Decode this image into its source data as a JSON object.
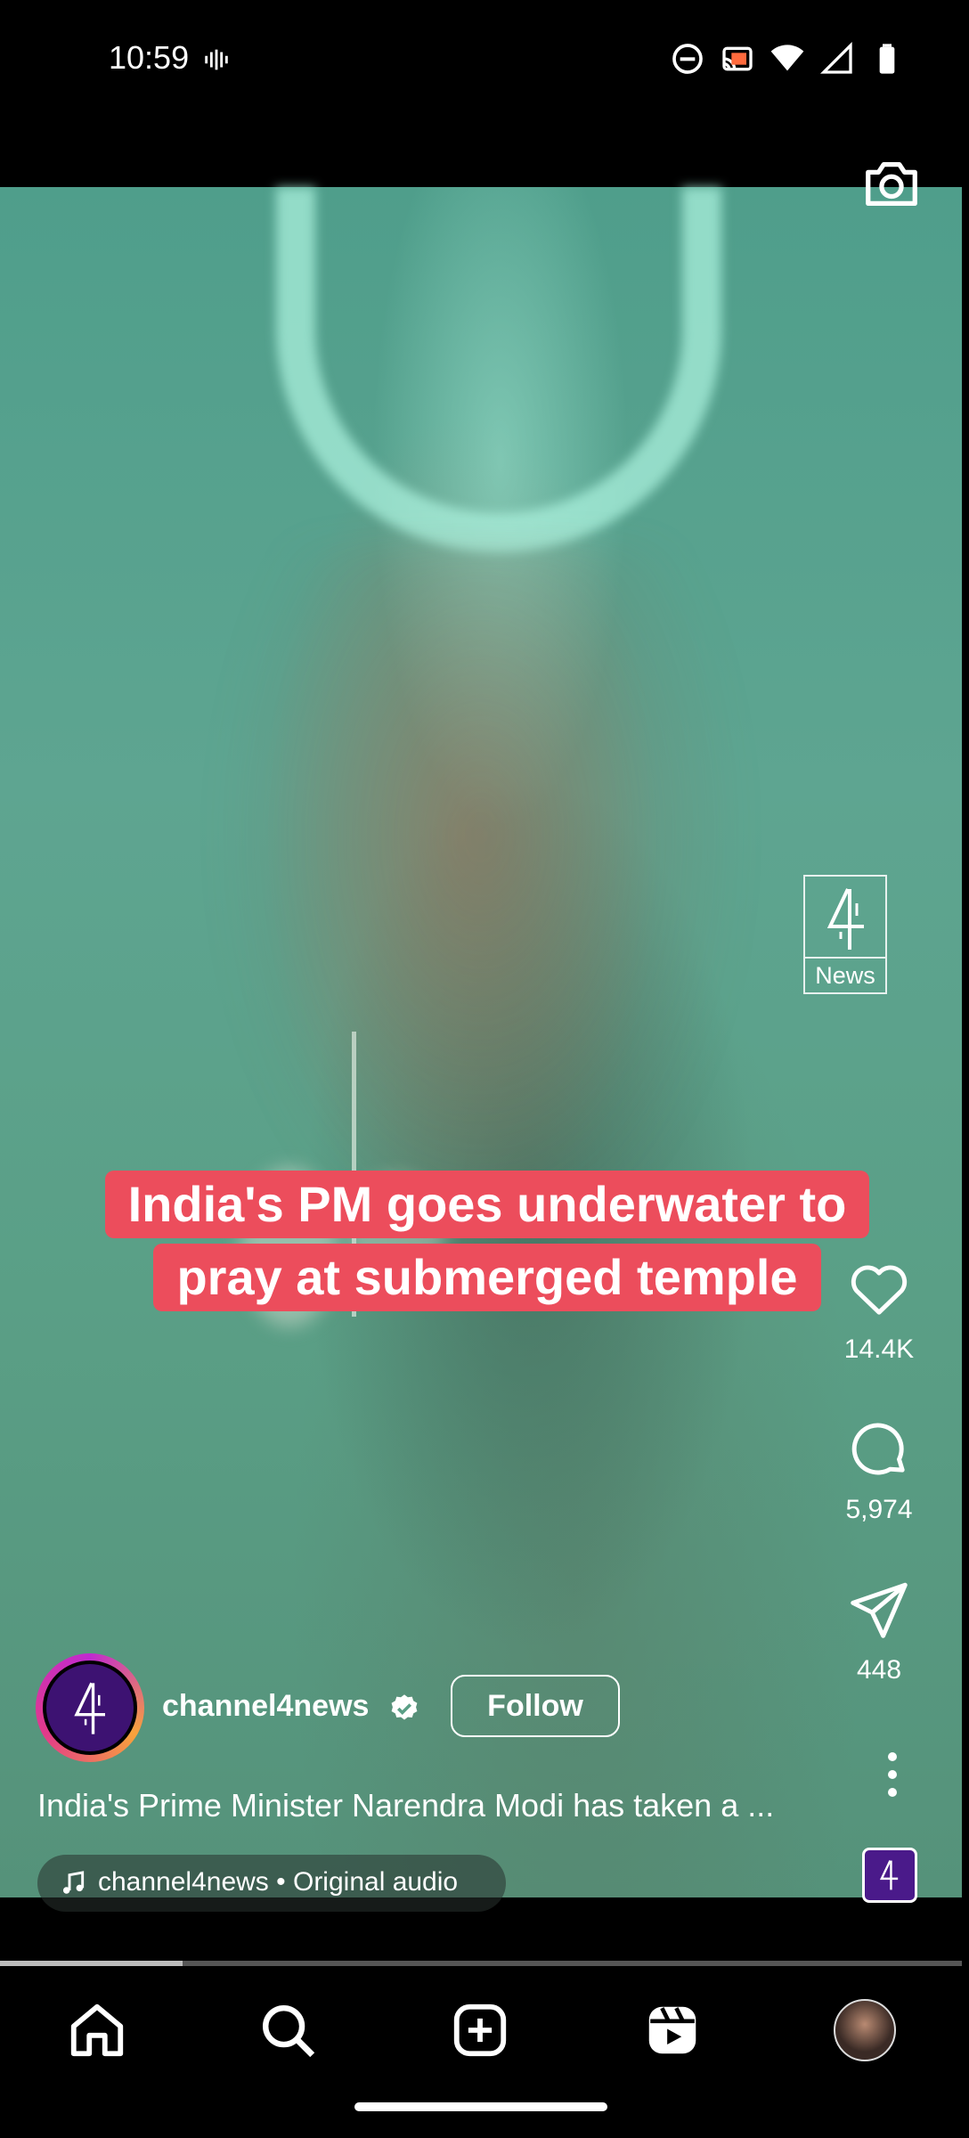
{
  "status_bar": {
    "time": "10:59",
    "icons": [
      "vibrate-icon",
      "do-not-disturb-icon",
      "cast-icon",
      "wifi-icon",
      "signal-icon",
      "battery-icon"
    ]
  },
  "video": {
    "watermark_text": "News",
    "caption_line1": "India's PM goes underwater to",
    "caption_line2": "pray at submerged temple",
    "progress": 0.19
  },
  "actions": {
    "like_count": "14.4K",
    "comment_count": "5,974",
    "share_count": "448"
  },
  "post": {
    "username": "channel4news",
    "follow_label": "Follow",
    "description": "India's Prime Minister Narendra Modi has taken a ...",
    "audio": "channel4news • Original audio"
  },
  "colors": {
    "caption_bg": "#ec4d5c",
    "avatar_bg": "#3d1272"
  },
  "nav": [
    "home-icon",
    "search-icon",
    "create-icon",
    "reels-icon",
    "profile-avatar"
  ]
}
